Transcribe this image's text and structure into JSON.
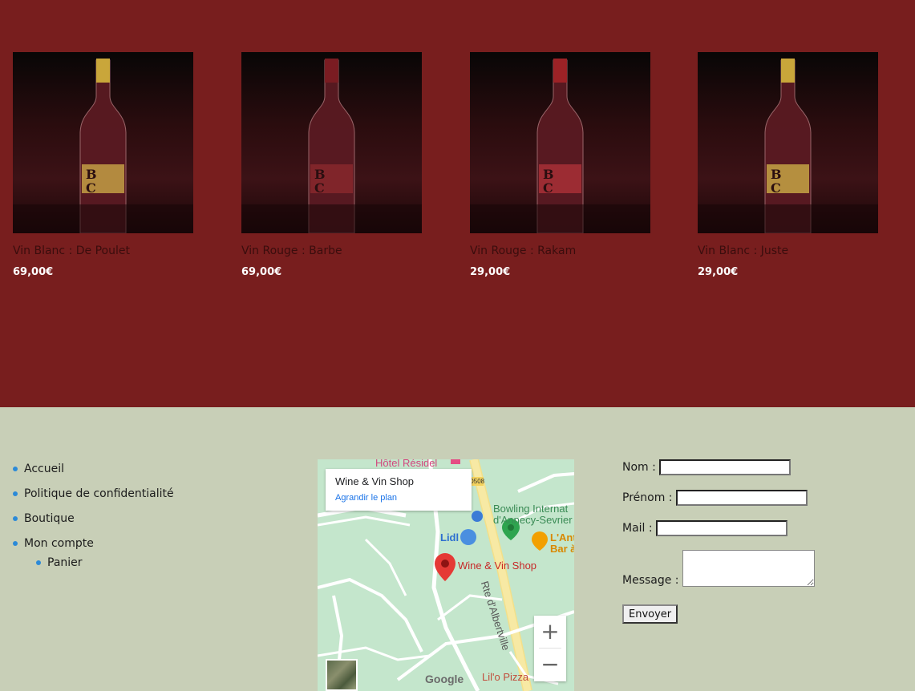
{
  "products": [
    {
      "name": "Vin Blanc : De Poulet",
      "price": "69,00€",
      "capsule_color": "#c9a63a",
      "label_color": "#d1b04a"
    },
    {
      "name": "Vin Rouge : Barbe",
      "price": "69,00€",
      "capsule_color": "#7a1c22",
      "label_color": "#8e2a2e"
    },
    {
      "name": "Vin Rouge : Rakam",
      "price": "29,00€",
      "capsule_color": "#9c2226",
      "label_color": "#b3333a"
    },
    {
      "name": "Vin Blanc : Juste",
      "price": "29,00€",
      "capsule_color": "#c9a63a",
      "label_color": "#d4b74a"
    }
  ],
  "product_label_letters": "B\nC",
  "footer_nav": {
    "items": [
      "Accueil",
      "Politique de confidentialité",
      "Boutique",
      "Mon compte"
    ],
    "subitems": [
      "Panier"
    ]
  },
  "map": {
    "card_title": "Wine & Vin Shop",
    "card_link": "Agrandir le plan",
    "labels": {
      "hotel": "Hôtel Résidel",
      "bowling_1": "Bowling Internat",
      "bowling_2": "d'Annecy-Sevrier",
      "lidl": "Lidl",
      "bar_1": "L'Ant",
      "bar_2": "Bar à",
      "shop": "Wine & Vin Shop",
      "road": "Rte d'Albertville",
      "road_badge": "D508",
      "pizza": "Lil'o Pizza",
      "google": "Google"
    },
    "zoom_in": "+",
    "zoom_out": "−"
  },
  "contact_form": {
    "nom_label": "Nom :",
    "prenom_label": "Prénom :",
    "mail_label": "Mail :",
    "message_label": "Message :",
    "submit_label": "Envoyer"
  },
  "colors": {
    "product_band": "#781e1e",
    "footer_bg": "#c8cfb7",
    "bullet": "#2b8ad8",
    "product_name": "#3a0d0d",
    "map_link": "#1a73e8"
  }
}
